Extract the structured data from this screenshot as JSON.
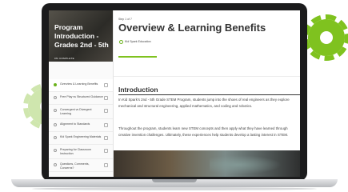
{
  "sidebar": {
    "title": "Program Introduction - Grades 2nd - 5th",
    "progress": "0% COMPLETE",
    "items": [
      {
        "label": "Overview & Learning Benefits"
      },
      {
        "label": "Free Play vs Structured Guidance"
      },
      {
        "label": "Convergent vs Divergent Learning"
      },
      {
        "label": "Alignment to Standards"
      },
      {
        "label": "Kid Spark Engineering Materials"
      },
      {
        "label": "Preparing for Classroom Instruction"
      },
      {
        "label": "Questions, Comments, Concerns?"
      }
    ]
  },
  "lesson": {
    "count": "Step 1 of 7",
    "title": "Overview & Learning Benefits",
    "author": "Kid Spark Education"
  },
  "content": {
    "heading": "Introduction",
    "paragraph1": "In Kid Spark's 2nd - 5th Grade STEM Program, students jump into the shoes of real engineers as they explore mechanical and structural engineering, applied mathematics, and coding and robotics.",
    "paragraph2": "Throughout the program, students learn new STEM concepts and then apply what they have learned through creative invention challenges. Ultimately, these experiences help students develop a lasting interest in STEM."
  },
  "colors": {
    "accent": "#7fc21f",
    "gear_light": "#cfe6ae",
    "laptop_frame": "#1b1b1c"
  }
}
